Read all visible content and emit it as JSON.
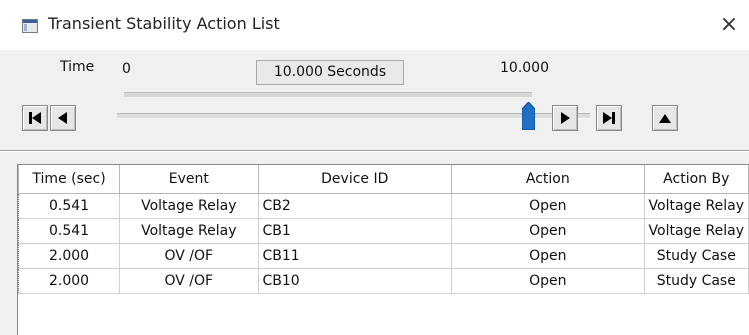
{
  "window": {
    "title": "Transient Stability Action List",
    "close_glyph": "×"
  },
  "time_bar": {
    "time_label": "Time",
    "start_value": "0",
    "current_display": "10.000 Seconds",
    "end_value": "10.000",
    "slider_position": 1.0
  },
  "controls": {
    "first_icon": "skip-to-start-icon",
    "prev_icon": "step-back-icon",
    "next_icon": "step-forward-icon",
    "last_icon": "skip-to-end-icon",
    "up_icon": "move-up-icon"
  },
  "table": {
    "columns": [
      "Time (sec)",
      "Event",
      "Device ID",
      "Action",
      "Action By"
    ],
    "rows": [
      [
        "0.541",
        "Voltage Relay",
        "CB2",
        "Open",
        "Voltage Relay"
      ],
      [
        "0.541",
        "Voltage Relay",
        "CB1",
        "Open",
        "Voltage Relay"
      ],
      [
        "2.000",
        "OV /OF",
        "CB11",
        "Open",
        "Study Case"
      ],
      [
        "2.000",
        "OV /OF",
        "CB10",
        "Open",
        "Study Case"
      ]
    ]
  },
  "colors": {
    "thumb": "#1f6fc5",
    "button_face": "#e6e6e6"
  }
}
